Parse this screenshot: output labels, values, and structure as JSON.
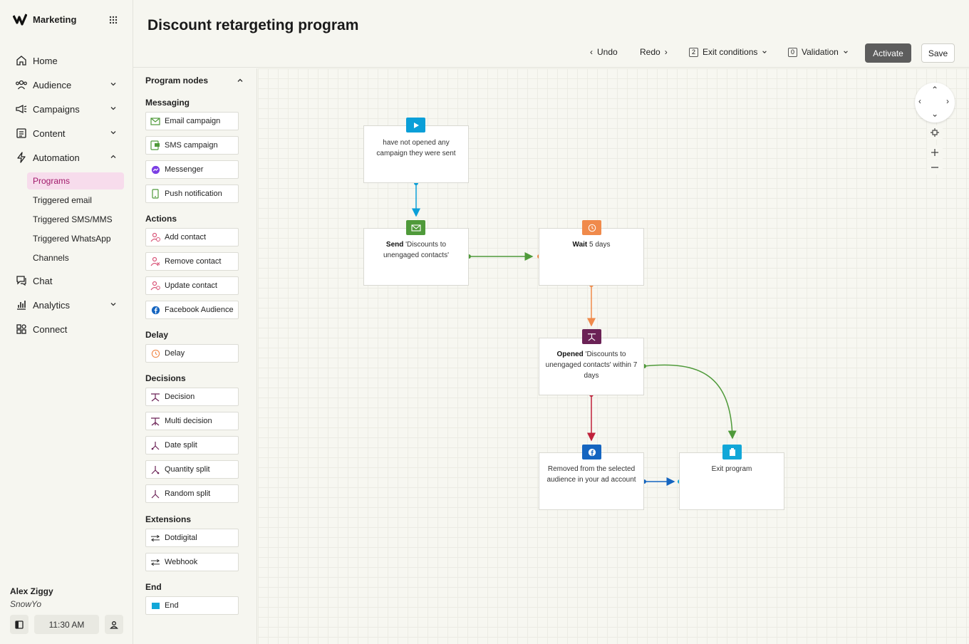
{
  "app": {
    "name": "Marketing"
  },
  "sidebar": {
    "items": [
      {
        "label": "Home",
        "icon": "home-icon"
      },
      {
        "label": "Audience",
        "icon": "audience-icon"
      },
      {
        "label": "Campaigns",
        "icon": "megaphone-icon"
      },
      {
        "label": "Content",
        "icon": "content-icon"
      },
      {
        "label": "Automation",
        "icon": "bolt-icon"
      },
      {
        "label": "Chat",
        "icon": "chat-icon"
      },
      {
        "label": "Analytics",
        "icon": "analytics-icon"
      },
      {
        "label": "Connect",
        "icon": "connect-icon"
      }
    ],
    "automation_sub": [
      "Programs",
      "Triggered email",
      "Triggered SMS/MMS",
      "Triggered WhatsApp",
      "Channels"
    ],
    "active_sub": "Programs"
  },
  "user": {
    "name": "Alex Ziggy",
    "org": "SnowYo",
    "time": "11:30 AM"
  },
  "header": {
    "title": "Discount retargeting program",
    "undo": "Undo",
    "redo": "Redo",
    "exit_count": "2",
    "exit_label": "Exit conditions",
    "validation_count": "0",
    "validation_label": "Validation",
    "activate": "Activate",
    "save": "Save"
  },
  "palette": {
    "title": "Program nodes",
    "messaging": {
      "title": "Messaging",
      "items": [
        "Email campaign",
        "SMS campaign",
        "Messenger",
        "Push notification"
      ]
    },
    "actions": {
      "title": "Actions",
      "items": [
        "Add contact",
        "Remove contact",
        "Update contact",
        "Facebook Audience"
      ]
    },
    "delay": {
      "title": "Delay",
      "items": [
        "Delay"
      ]
    },
    "decisions": {
      "title": "Decisions",
      "items": [
        "Decision",
        "Multi decision",
        "Date split",
        "Quantity split",
        "Random split"
      ]
    },
    "extensions": {
      "title": "Extensions",
      "items": [
        "Dotdigital",
        "Webhook"
      ]
    },
    "end": {
      "title": "End",
      "items": [
        "End"
      ]
    }
  },
  "canvas": {
    "start": {
      "text": "have not opened any campaign they were sent"
    },
    "send": {
      "bold": "Send",
      "text": " 'Discounts to unengaged contacts'"
    },
    "wait": {
      "bold": "Wait",
      "text": " 5 days"
    },
    "opened": {
      "bold": "Opened",
      "text": " 'Discounts to unengaged contacts' within 7 days"
    },
    "removed": {
      "text": "Removed from the selected audience in your ad account"
    },
    "exit": {
      "text": "Exit program"
    }
  },
  "colors": {
    "accent": "#a11a6b",
    "start": "#0a9fd8",
    "send": "#4f9a3a",
    "wait": "#f08a4b",
    "decision": "#6b2256",
    "facebook": "#1565c0",
    "exit": "#12a7d8",
    "red": "#c0213b"
  }
}
